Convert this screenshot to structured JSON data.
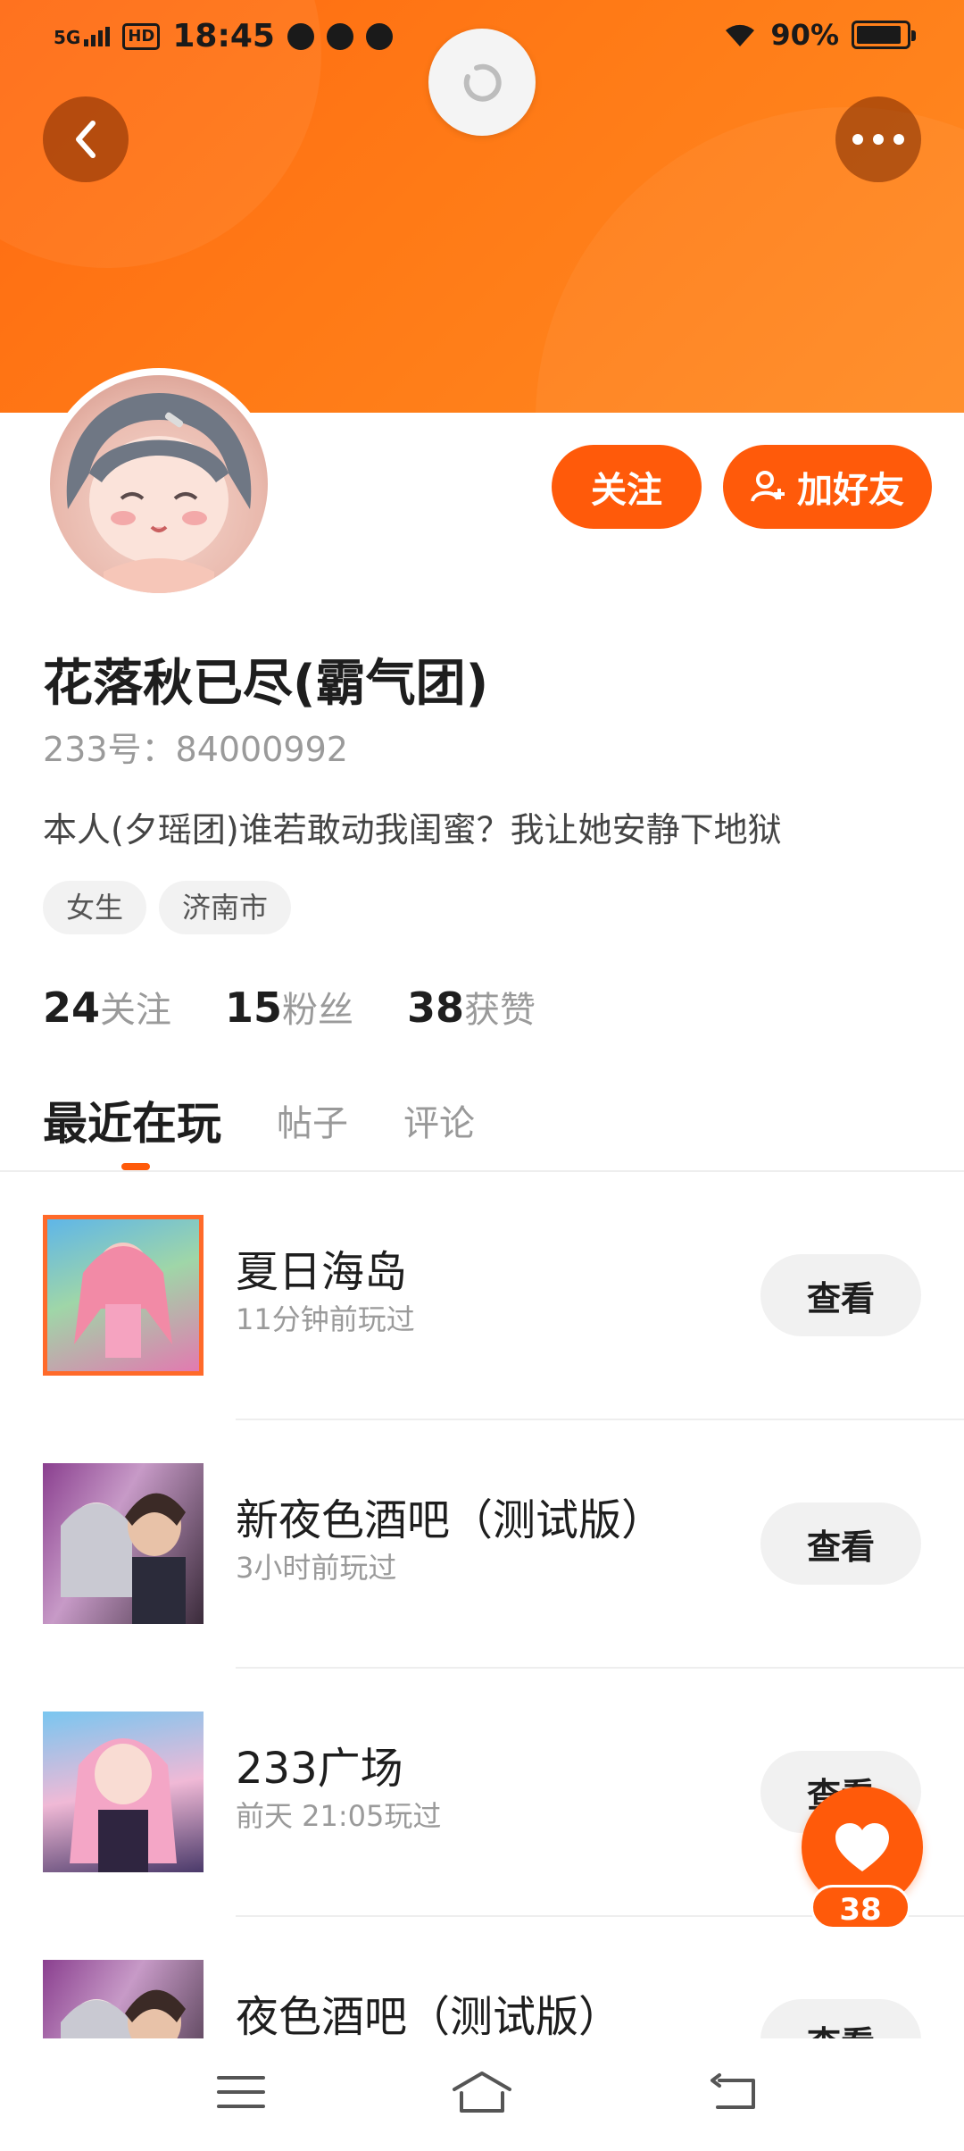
{
  "status_bar": {
    "signal": "5G",
    "hd": "HD",
    "time": "18:45",
    "battery_percent": "90%",
    "battery_level": 0.9
  },
  "header": {
    "back_icon": "chevron-left-icon",
    "more_icon": "more-dots-icon",
    "refresh_icon": "refresh-icon"
  },
  "actions": {
    "follow_label": "关注",
    "add_friend_label": "加好友"
  },
  "profile": {
    "name": "花落秋已尽(霸气团)",
    "uid": "233号：84000992",
    "bio": "本人(夕瑶团)谁若敢动我闺蜜？我让她安静下地狱",
    "tags": [
      "女生",
      "济南市"
    ],
    "stats": [
      {
        "num": "24",
        "label": "关注"
      },
      {
        "num": "15",
        "label": "粉丝"
      },
      {
        "num": "38",
        "label": "获赞"
      }
    ]
  },
  "tabs": [
    {
      "label": "最近在玩",
      "active": true
    },
    {
      "label": "帖子",
      "active": false
    },
    {
      "label": "评论",
      "active": false
    }
  ],
  "games": [
    {
      "title": "夏日海岛",
      "time": "11分钟前玩过",
      "button": "查看"
    },
    {
      "title": "新夜色酒吧（测试版）",
      "time": "3小时前玩过",
      "button": "查看"
    },
    {
      "title": "233广场",
      "time": "前天 21:05玩过",
      "button": "查看"
    },
    {
      "title": "夜色酒吧（测试版）",
      "time": "",
      "button": "查看"
    }
  ],
  "like": {
    "count": "38"
  },
  "colors": {
    "accent": "#ff5a0a",
    "banner": "#ff7a16"
  }
}
